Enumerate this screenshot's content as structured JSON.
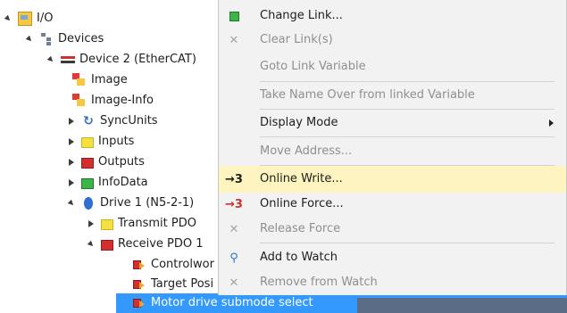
{
  "tree": {
    "io": "I/O",
    "devices": "Devices",
    "device2": "Device 2 (EtherCAT)",
    "image": "Image",
    "image_info": "Image-Info",
    "syncunits": "SyncUnits",
    "inputs": "Inputs",
    "outputs": "Outputs",
    "infodata": "InfoData",
    "drive1": "Drive 1 (N5-2-1)",
    "transmit_pdo": "Transmit PDO",
    "receive_pdo": "Receive PDO 1",
    "controlword": "Controlwor",
    "target_pos": "Target Posi",
    "motor_submode": "Motor drive submode select"
  },
  "menu": {
    "change_link": "Change Link...",
    "clear_links": "Clear Link(s)",
    "goto_link_variable": "Goto Link Variable",
    "take_name": "Take Name Over from linked Variable",
    "display_mode": "Display Mode",
    "move_address": "Move Address...",
    "online_write": "Online Write...",
    "online_force": "Online Force...",
    "release_force": "Release Force",
    "add_to_watch": "Add to Watch",
    "remove_from_watch": "Remove from Watch",
    "online_write_glyph": "→3",
    "online_force_glyph": "→3"
  },
  "colors": {
    "menu_hover": "#fdf4bf",
    "selection": "#3399ff",
    "disabled_text": "#8f8f8f"
  },
  "icons": {
    "io": "folder-io-icon",
    "devices": "devices-icon",
    "device2": "ethercat-device-icon",
    "change_link": "link-icon",
    "clear_links": "clear-link-icon",
    "online_write": "online-write-icon",
    "online_force": "online-force-icon",
    "release_force": "release-force-icon",
    "add_to_watch": "magnifier-icon",
    "remove_from_watch": "remove-watch-icon"
  }
}
